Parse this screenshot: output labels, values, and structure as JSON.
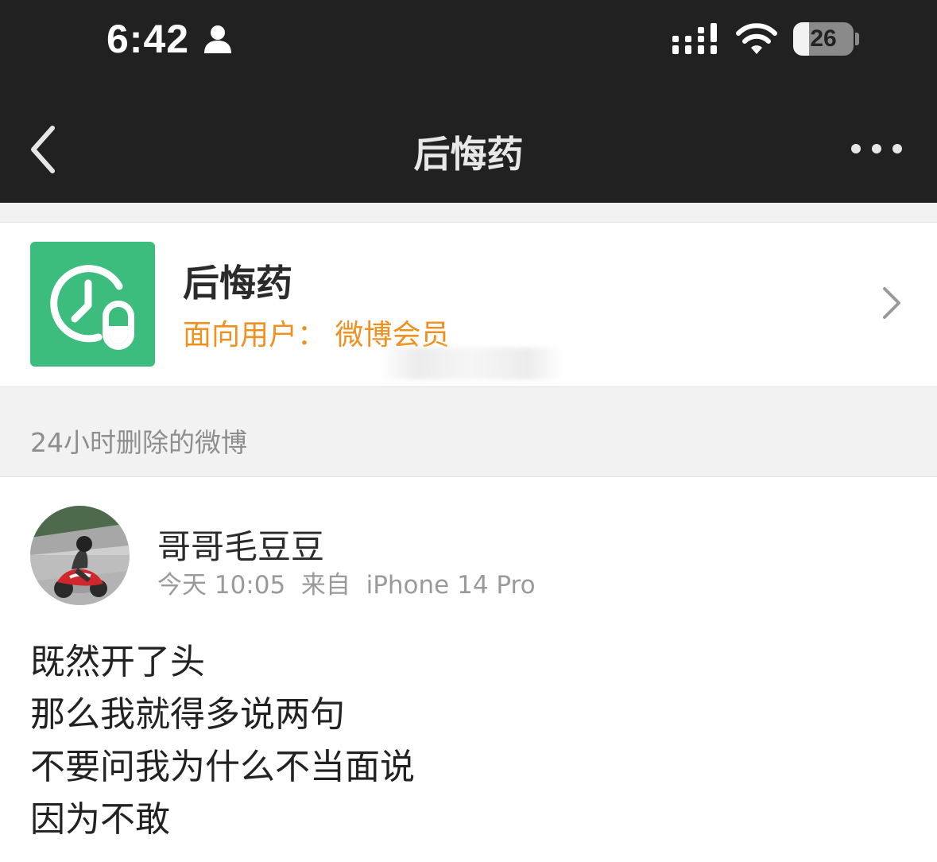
{
  "status_bar": {
    "time": "6:42",
    "battery_level": "26",
    "battery_fraction": 0.26,
    "icons": [
      "person-icon",
      "signal-icon",
      "wifi-icon",
      "battery-icon"
    ]
  },
  "nav": {
    "title": "后悔药",
    "icons": [
      "back-icon",
      "more-icon"
    ]
  },
  "feature": {
    "title": "后悔药",
    "subtitle": "面向用户： 微博会员",
    "icons": [
      "clock-pill-logo-icon",
      "chevron-right-icon"
    ],
    "colors": {
      "logo_bg": "#3dbd7d",
      "subtitle": "#f0901e"
    }
  },
  "section": {
    "title": "24小时删除的微博"
  },
  "post": {
    "username": "哥哥毛豆豆",
    "meta": "今天 10:05  来自  iPhone 14 Pro",
    "lines": [
      "既然开了头",
      "那么我就得多说两句",
      "不要问我为什么不当面说",
      "因为不敢"
    ]
  },
  "colors": {
    "topbar_bg": "#212121",
    "section_bg": "#f2f2f2"
  }
}
